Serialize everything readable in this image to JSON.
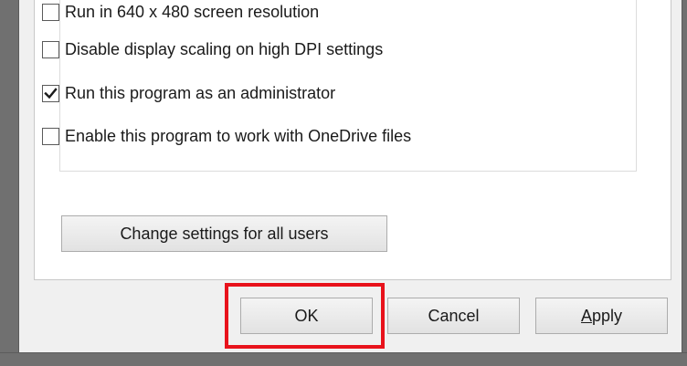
{
  "checkboxes": [
    {
      "label": "Run in 640 x 480 screen resolution",
      "checked": false
    },
    {
      "label": "Disable display scaling on high DPI settings",
      "checked": false
    },
    {
      "label": "Run this program as an administrator",
      "checked": true
    },
    {
      "label": "Enable this program to work with OneDrive files",
      "checked": false
    }
  ],
  "buttons": {
    "change_settings": "Change settings for all users",
    "ok": "OK",
    "cancel": "Cancel",
    "apply_accel": "A",
    "apply_rest": "pply"
  },
  "colors": {
    "highlight_border": "#e8121b",
    "window_frame": "#707070",
    "dialog_background": "#f0f0f0",
    "panel_background": "#ffffff"
  },
  "icons": {
    "checkmark": "checkmark-icon"
  }
}
